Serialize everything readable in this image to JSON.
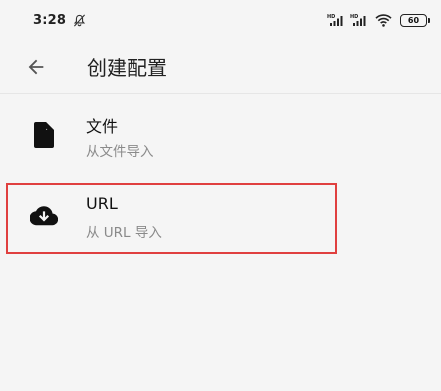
{
  "status_bar": {
    "time": "3:28",
    "battery": "60",
    "icons": [
      "mute-icon",
      "signal-hd-icon",
      "signal-hd-icon",
      "wifi-icon",
      "battery-icon"
    ]
  },
  "app_bar": {
    "title": "创建配置",
    "back_icon": "arrow-left-icon"
  },
  "items": [
    {
      "title": "文件",
      "subtitle": "从文件导入",
      "icon": "file-icon"
    },
    {
      "title": "URL",
      "subtitle": "从 URL 导入",
      "icon": "cloud-download-icon"
    }
  ],
  "colors": {
    "background": "#f5f5f5",
    "highlight": "#e0403f",
    "subtitle": "#8a8a8a"
  }
}
